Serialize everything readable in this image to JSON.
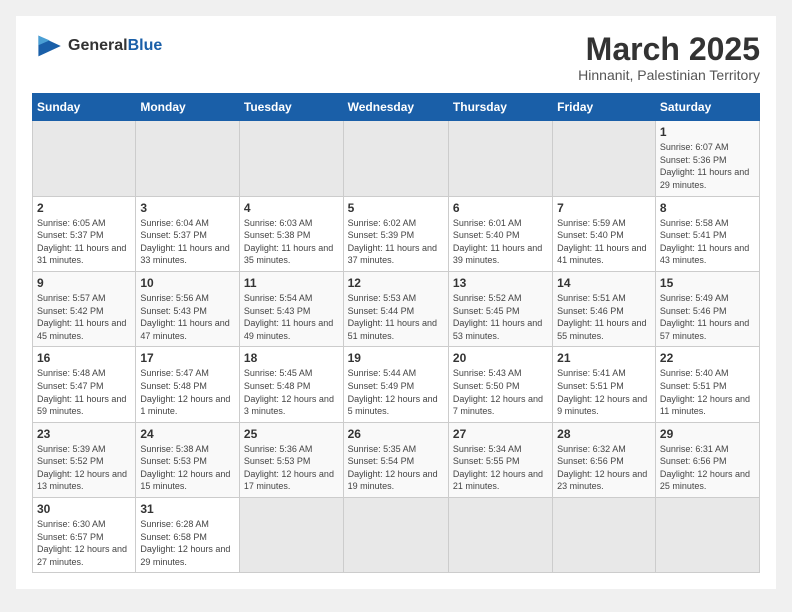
{
  "logo": {
    "line1": "General",
    "line2": "Blue"
  },
  "title": "March 2025",
  "subtitle": "Hinnanit, Palestinian Territory",
  "weekdays": [
    "Sunday",
    "Monday",
    "Tuesday",
    "Wednesday",
    "Thursday",
    "Friday",
    "Saturday"
  ],
  "weeks": [
    [
      {
        "day": "",
        "info": ""
      },
      {
        "day": "",
        "info": ""
      },
      {
        "day": "",
        "info": ""
      },
      {
        "day": "",
        "info": ""
      },
      {
        "day": "",
        "info": ""
      },
      {
        "day": "",
        "info": ""
      },
      {
        "day": "1",
        "info": "Sunrise: 6:07 AM\nSunset: 5:36 PM\nDaylight: 11 hours and 29 minutes."
      }
    ],
    [
      {
        "day": "2",
        "info": "Sunrise: 6:05 AM\nSunset: 5:37 PM\nDaylight: 11 hours and 31 minutes."
      },
      {
        "day": "3",
        "info": "Sunrise: 6:04 AM\nSunset: 5:37 PM\nDaylight: 11 hours and 33 minutes."
      },
      {
        "day": "4",
        "info": "Sunrise: 6:03 AM\nSunset: 5:38 PM\nDaylight: 11 hours and 35 minutes."
      },
      {
        "day": "5",
        "info": "Sunrise: 6:02 AM\nSunset: 5:39 PM\nDaylight: 11 hours and 37 minutes."
      },
      {
        "day": "6",
        "info": "Sunrise: 6:01 AM\nSunset: 5:40 PM\nDaylight: 11 hours and 39 minutes."
      },
      {
        "day": "7",
        "info": "Sunrise: 5:59 AM\nSunset: 5:40 PM\nDaylight: 11 hours and 41 minutes."
      },
      {
        "day": "8",
        "info": "Sunrise: 5:58 AM\nSunset: 5:41 PM\nDaylight: 11 hours and 43 minutes."
      }
    ],
    [
      {
        "day": "9",
        "info": "Sunrise: 5:57 AM\nSunset: 5:42 PM\nDaylight: 11 hours and 45 minutes."
      },
      {
        "day": "10",
        "info": "Sunrise: 5:56 AM\nSunset: 5:43 PM\nDaylight: 11 hours and 47 minutes."
      },
      {
        "day": "11",
        "info": "Sunrise: 5:54 AM\nSunset: 5:43 PM\nDaylight: 11 hours and 49 minutes."
      },
      {
        "day": "12",
        "info": "Sunrise: 5:53 AM\nSunset: 5:44 PM\nDaylight: 11 hours and 51 minutes."
      },
      {
        "day": "13",
        "info": "Sunrise: 5:52 AM\nSunset: 5:45 PM\nDaylight: 11 hours and 53 minutes."
      },
      {
        "day": "14",
        "info": "Sunrise: 5:51 AM\nSunset: 5:46 PM\nDaylight: 11 hours and 55 minutes."
      },
      {
        "day": "15",
        "info": "Sunrise: 5:49 AM\nSunset: 5:46 PM\nDaylight: 11 hours and 57 minutes."
      }
    ],
    [
      {
        "day": "16",
        "info": "Sunrise: 5:48 AM\nSunset: 5:47 PM\nDaylight: 11 hours and 59 minutes."
      },
      {
        "day": "17",
        "info": "Sunrise: 5:47 AM\nSunset: 5:48 PM\nDaylight: 12 hours and 1 minute."
      },
      {
        "day": "18",
        "info": "Sunrise: 5:45 AM\nSunset: 5:48 PM\nDaylight: 12 hours and 3 minutes."
      },
      {
        "day": "19",
        "info": "Sunrise: 5:44 AM\nSunset: 5:49 PM\nDaylight: 12 hours and 5 minutes."
      },
      {
        "day": "20",
        "info": "Sunrise: 5:43 AM\nSunset: 5:50 PM\nDaylight: 12 hours and 7 minutes."
      },
      {
        "day": "21",
        "info": "Sunrise: 5:41 AM\nSunset: 5:51 PM\nDaylight: 12 hours and 9 minutes."
      },
      {
        "day": "22",
        "info": "Sunrise: 5:40 AM\nSunset: 5:51 PM\nDaylight: 12 hours and 11 minutes."
      }
    ],
    [
      {
        "day": "23",
        "info": "Sunrise: 5:39 AM\nSunset: 5:52 PM\nDaylight: 12 hours and 13 minutes."
      },
      {
        "day": "24",
        "info": "Sunrise: 5:38 AM\nSunset: 5:53 PM\nDaylight: 12 hours and 15 minutes."
      },
      {
        "day": "25",
        "info": "Sunrise: 5:36 AM\nSunset: 5:53 PM\nDaylight: 12 hours and 17 minutes."
      },
      {
        "day": "26",
        "info": "Sunrise: 5:35 AM\nSunset: 5:54 PM\nDaylight: 12 hours and 19 minutes."
      },
      {
        "day": "27",
        "info": "Sunrise: 5:34 AM\nSunset: 5:55 PM\nDaylight: 12 hours and 21 minutes."
      },
      {
        "day": "28",
        "info": "Sunrise: 6:32 AM\nSunset: 6:56 PM\nDaylight: 12 hours and 23 minutes."
      },
      {
        "day": "29",
        "info": "Sunrise: 6:31 AM\nSunset: 6:56 PM\nDaylight: 12 hours and 25 minutes."
      }
    ],
    [
      {
        "day": "30",
        "info": "Sunrise: 6:30 AM\nSunset: 6:57 PM\nDaylight: 12 hours and 27 minutes."
      },
      {
        "day": "31",
        "info": "Sunrise: 6:28 AM\nSunset: 6:58 PM\nDaylight: 12 hours and 29 minutes."
      },
      {
        "day": "",
        "info": ""
      },
      {
        "day": "",
        "info": ""
      },
      {
        "day": "",
        "info": ""
      },
      {
        "day": "",
        "info": ""
      },
      {
        "day": "",
        "info": ""
      }
    ]
  ]
}
